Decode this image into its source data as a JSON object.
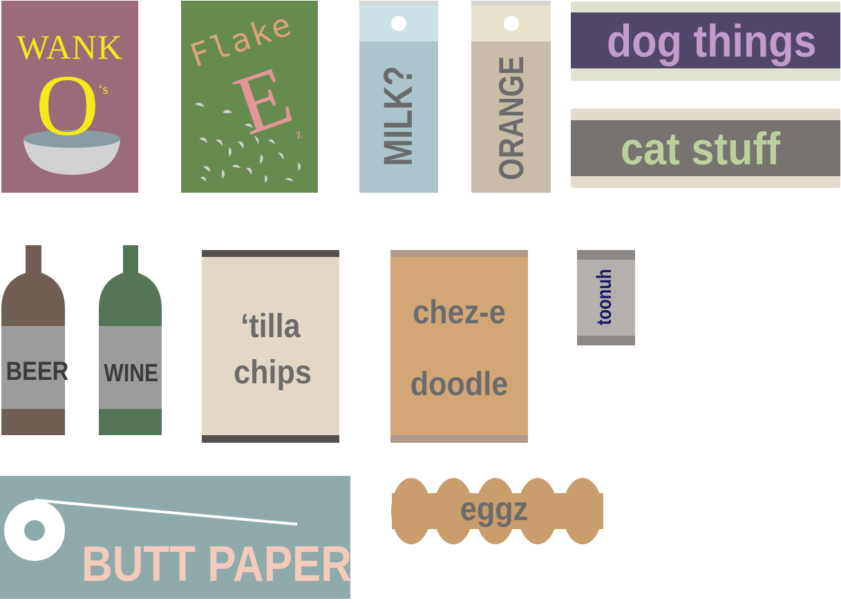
{
  "colors": {
    "cereal_bg": "#9c6b7a",
    "cereal_text": "#f3ea1c",
    "bowl": "#d2d2d2",
    "bowl_milk": "#879da3",
    "flakes_bg": "#658b4f",
    "flakes_text": "#e1a179",
    "flakes_e": "#e49696",
    "milk_body": "#acc4cb",
    "milk_top": "#cce2e7",
    "orange_body": "#c9bca9",
    "orange_top": "#e9e3cd",
    "label_text_gray": "#6b6b6b",
    "dog_band": "#51476a",
    "dog_text": "#c39cce",
    "cat_band": "#767370",
    "cat_text": "#bcd09d",
    "bin_bg": "#e3dbcd",
    "beer": "#725e54",
    "wine": "#557559",
    "bottle_label": "#9c9c9c",
    "chips_bg": "#e3d8c8",
    "chips_band": "#55504e",
    "cheese_bg": "#d2a676",
    "cheese_band": "#ae998a",
    "tuna_bg": "#b3b0ae",
    "tuna_band": "#8a8784",
    "tuna_text": "#1a1a63",
    "tp_bg": "#8eaaab",
    "tp_text": "#f4cabc",
    "eggs": "#c99d6c"
  },
  "labels": {
    "cereal": {
      "brand": "WANK",
      "big_letter": "O",
      "suffix": "‘s"
    },
    "flakes": {
      "word": "Flake",
      "big_letter": "E",
      "suffix": "z"
    },
    "milk": "MILK?",
    "orange": "ORANGE",
    "dog": "dog things",
    "cat": "cat stuff",
    "beer": "BEER",
    "wine": "WINE",
    "chips": {
      "line1": "‘tilla",
      "line2": "chips"
    },
    "cheese": {
      "line1": "chez-e",
      "line2": "doodle"
    },
    "tuna": "toonuh",
    "toilet_paper": "BUTT PAPER",
    "eggs": "eggz"
  }
}
